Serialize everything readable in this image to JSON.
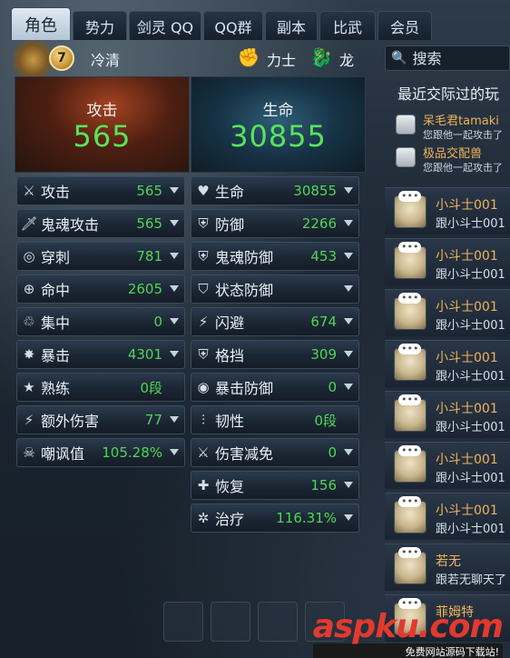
{
  "tabs": [
    {
      "label": "角色",
      "active": true
    },
    {
      "label": "势力",
      "active": false
    },
    {
      "label": "剑灵 QQ",
      "active": false
    },
    {
      "label": "QQ群",
      "active": false
    },
    {
      "label": "副本",
      "active": false
    },
    {
      "label": "比武",
      "active": false
    },
    {
      "label": "会员",
      "active": false
    }
  ],
  "header": {
    "level": "7",
    "char_name": "冷清",
    "class_label": "力士",
    "race_label": "龙"
  },
  "big": {
    "attack_label": "攻击",
    "attack_value": "565",
    "hp_label": "生命",
    "hp_value": "30855"
  },
  "left_stats": [
    {
      "icon": "swords-icon",
      "glyph": "⚔",
      "label": "攻击",
      "value": "565"
    },
    {
      "icon": "ghost-sword-icon",
      "glyph": "🗡",
      "label": "鬼魂攻击",
      "value": "565"
    },
    {
      "icon": "pierce-icon",
      "glyph": "◎",
      "label": "穿刺",
      "value": "781"
    },
    {
      "icon": "crosshair-icon",
      "glyph": "⊕",
      "label": "命中",
      "value": "2605"
    },
    {
      "icon": "focus-icon",
      "glyph": "♲",
      "label": "集中",
      "value": "0"
    },
    {
      "icon": "burst-icon",
      "glyph": "✸",
      "label": "暴击",
      "value": "4301"
    },
    {
      "icon": "star-hand-icon",
      "glyph": "★",
      "label": "熟练",
      "value": "0段"
    },
    {
      "icon": "lightning-icon",
      "glyph": "⚡",
      "label": "额外伤害",
      "value": "77"
    },
    {
      "icon": "skull-icon",
      "glyph": "☠",
      "label": "嘲讽值",
      "value": "105.28%"
    }
  ],
  "right_stats": [
    {
      "icon": "heart-icon",
      "glyph": "♥",
      "label": "生命",
      "value": "30855"
    },
    {
      "icon": "shield-icon",
      "glyph": "⛨",
      "label": "防御",
      "value": "2266"
    },
    {
      "icon": "ghost-shield-icon",
      "glyph": "⛨",
      "label": "鬼魂防御",
      "value": "453"
    },
    {
      "icon": "status-shield-icon",
      "glyph": "⛉",
      "label": "状态防御",
      "value": ""
    },
    {
      "icon": "dodge-icon",
      "glyph": "⚡",
      "label": "闪避",
      "value": "674"
    },
    {
      "icon": "block-icon",
      "glyph": "⛨",
      "label": "格挡",
      "value": "309"
    },
    {
      "icon": "crit-defense-icon",
      "glyph": "◉",
      "label": "暴击防御",
      "value": "0"
    },
    {
      "icon": "toughness-icon",
      "glyph": "⫶",
      "label": "韧性",
      "value": "0段"
    },
    {
      "icon": "damage-reduction-icon",
      "glyph": "⚔",
      "label": "伤害减免",
      "value": "0"
    },
    {
      "icon": "recovery-icon",
      "glyph": "✚",
      "label": "恢复",
      "value": "156"
    },
    {
      "icon": "heal-icon",
      "glyph": "✲",
      "label": "治疗",
      "value": "116.31%"
    }
  ],
  "side": {
    "search_placeholder": "搜索",
    "recent_title": "最近交际过的玩",
    "recent": [
      {
        "name": "呆毛君tamaki",
        "text": "您跟他一起攻击了"
      },
      {
        "name": "极品交配兽",
        "text": "您跟他一起攻击了"
      }
    ],
    "chats": [
      {
        "name": "小斗士001",
        "text": "跟小斗士001"
      },
      {
        "name": "小斗士001",
        "text": "跟小斗士001"
      },
      {
        "name": "小斗士001",
        "text": "跟小斗士001"
      },
      {
        "name": "小斗士001",
        "text": "跟小斗士001"
      },
      {
        "name": "小斗士001",
        "text": "跟小斗士001"
      },
      {
        "name": "小斗士001",
        "text": "跟小斗士001"
      },
      {
        "name": "小斗士001",
        "text": "跟小斗士001"
      },
      {
        "name": "若无",
        "text": "跟若无聊天了"
      },
      {
        "name": "菲姆特",
        "text": ""
      }
    ]
  },
  "watermark": {
    "logo": "aspku.com",
    "sub": "免费网站源码下载站!"
  }
}
